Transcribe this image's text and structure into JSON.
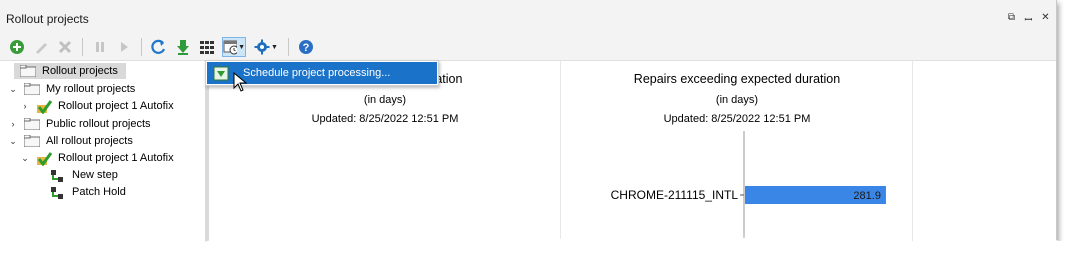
{
  "window": {
    "title": "Rollout projects"
  },
  "toolbar": {
    "buttons": [
      {
        "name": "add-icon"
      },
      {
        "name": "edit-icon"
      },
      {
        "name": "delete-icon"
      },
      {
        "name": "pause-icon"
      },
      {
        "name": "play-icon"
      },
      {
        "name": "refresh-icon"
      },
      {
        "name": "download-icon"
      },
      {
        "name": "grid-icon"
      },
      {
        "name": "schedule-icon"
      },
      {
        "name": "gear-icon"
      },
      {
        "name": "help-icon"
      }
    ]
  },
  "menu": {
    "schedule_label": "Schedule project processing..."
  },
  "tree": {
    "root": "Rollout projects",
    "my": "My rollout projects",
    "my_child": "Rollout project 1 Autofix",
    "public": "Public rollout projects",
    "all": "All rollout projects",
    "all_child": "Rollout project 1 Autofix",
    "step1": "New step",
    "step2": "Patch Hold"
  },
  "left_chart": {
    "title_visible": "xpected duration",
    "subtitle": "(in days)",
    "updated": "Updated: 8/25/2022 12:51 PM"
  },
  "right_chart": {
    "title": "Repairs exceeding expected duration",
    "subtitle": "(in days)",
    "updated": "Updated: 8/25/2022 12:51 PM"
  },
  "chart_data": {
    "type": "bar",
    "categories": [
      "CHROME-211115_INTL"
    ],
    "values": [
      281.9
    ],
    "title": "Repairs exceeding expected duration",
    "subtitle": "(in days)",
    "bar_color": "#3a86e6"
  }
}
